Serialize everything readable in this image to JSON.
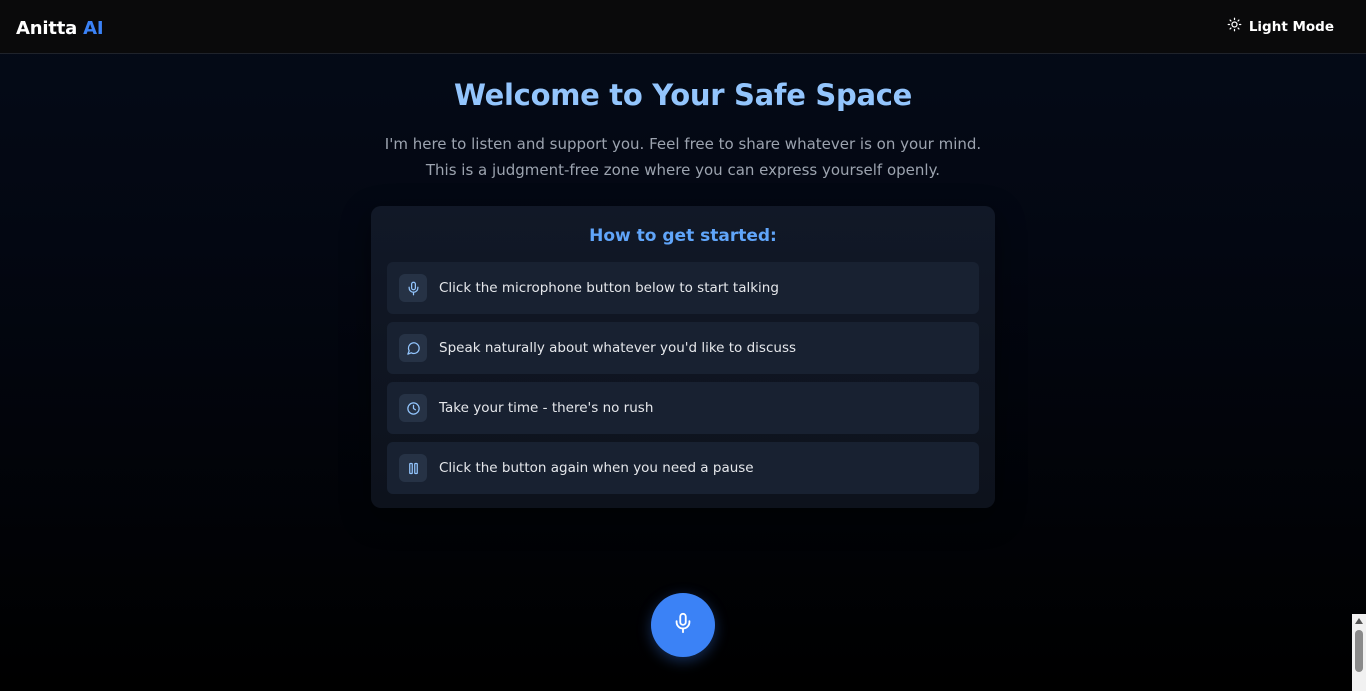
{
  "header": {
    "brand_main": "Anitta",
    "brand_accent": "AI",
    "theme_toggle_label": "Light Mode",
    "theme_toggle_icon": "sun-icon"
  },
  "hero": {
    "title": "Welcome to Your Safe Space",
    "intro": "I'm here to listen and support you. Feel free to share whatever is on your mind. This is a judgment-free zone where you can express yourself openly."
  },
  "guide": {
    "title": "How to get started:",
    "steps": [
      {
        "icon": "microphone-icon",
        "label": "Click the microphone button below to start talking"
      },
      {
        "icon": "chat-bubble-icon",
        "label": "Speak naturally about whatever you'd like to discuss"
      },
      {
        "icon": "clock-icon",
        "label": "Take your time - there's no rush"
      },
      {
        "icon": "pause-icon",
        "label": "Click the button again when you need a pause"
      }
    ]
  },
  "controls": {
    "mic_button_icon": "microphone-icon"
  },
  "colors": {
    "accent": "#3b82f6",
    "title": "#93c5fd",
    "guide_title": "#60a5fa",
    "background": "#030712"
  }
}
